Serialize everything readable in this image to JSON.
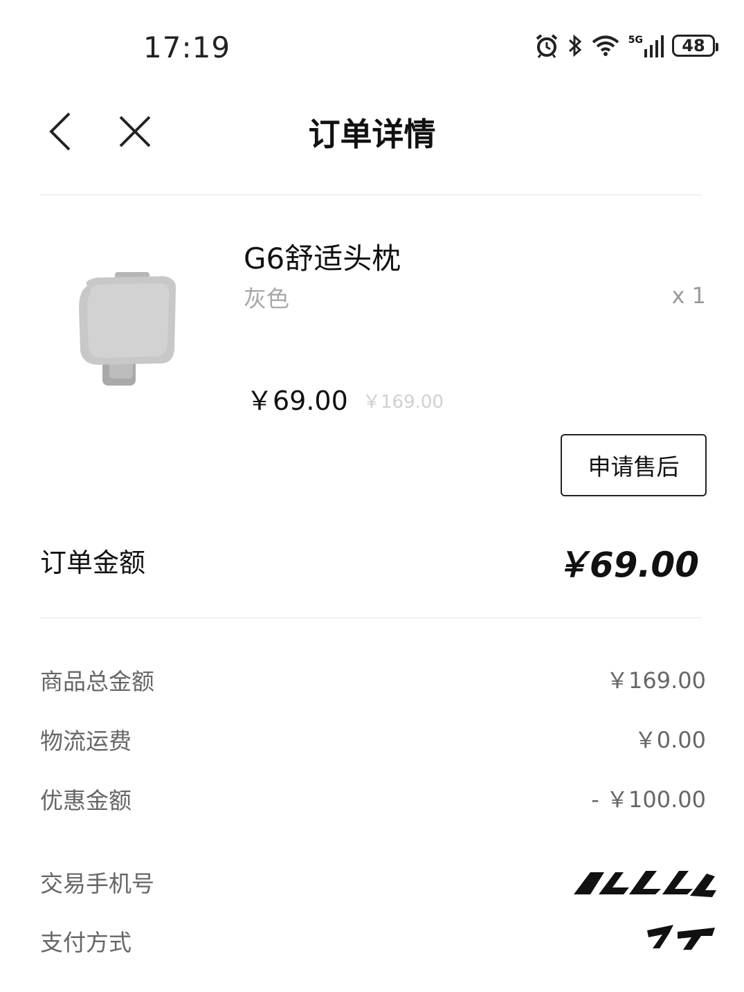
{
  "status_bar": {
    "time": "17:19",
    "network": "5G",
    "battery": "48",
    "icons": [
      "alarm-icon",
      "bluetooth-icon",
      "wifi-icon",
      "signal-icon",
      "battery-icon"
    ]
  },
  "nav": {
    "title": "订单详情",
    "back_icon": "chevron-left-icon",
    "close_icon": "close-icon"
  },
  "product": {
    "name": "G6舒适头枕",
    "variant": "灰色",
    "quantity": "x 1",
    "price": "￥69.00",
    "original_price": "￥169.00",
    "after_sale_label": "申请售后"
  },
  "order_total": {
    "label": "订单金额",
    "value": "￥69.00"
  },
  "breakdown": {
    "goods_total_label": "商品总金额",
    "goods_total_value": "￥169.00",
    "shipping_label": "物流运费",
    "shipping_value": "￥0.00",
    "discount_label": "优惠金额",
    "discount_value": "- ￥100.00"
  },
  "info": {
    "phone_label": "交易手机号",
    "payment_label": "支付方式"
  },
  "colors": {
    "text_primary": "#111111",
    "text_secondary": "#666666",
    "text_muted": "#a8a8a8",
    "divider": "#e6e6e6"
  }
}
